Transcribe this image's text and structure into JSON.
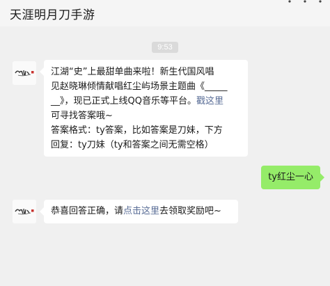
{
  "window": {
    "title": "天涯明月刀手游",
    "more_icon": "more-dots-icon"
  },
  "chat": {
    "timestamp": "9:53",
    "messages": [
      {
        "from": "official-account",
        "avatar_icon": "game-logo-avatar-icon",
        "lines": [
          "江湖“史”上最甜单曲来啦！新生代国风唱",
          "见赵晓琳倾情献唱红尘屿场景主题曲《_____",
          "__》，现已正式上线QQ音乐等平台。",
          "可寻找答案哦~",
          "答案格式：ty答案，比如答案是刀妹，下方",
          "回复：ty刀妹（ty和答案之间无需空格）"
        ],
        "link_text": "戳这里"
      },
      {
        "from": "me",
        "text": "ty红尘一心"
      },
      {
        "from": "official-account",
        "avatar_icon": "game-logo-avatar-icon",
        "prefix": "恭喜回答正确，请",
        "link_text": "点击这里",
        "suffix": "去领取奖励吧~"
      }
    ]
  },
  "colors": {
    "background": "#f0f0f0",
    "bubble_received": "#ffffff",
    "bubble_sent": "#95ec69",
    "link": "#576b95",
    "timestamp_bg": "#dadada"
  }
}
